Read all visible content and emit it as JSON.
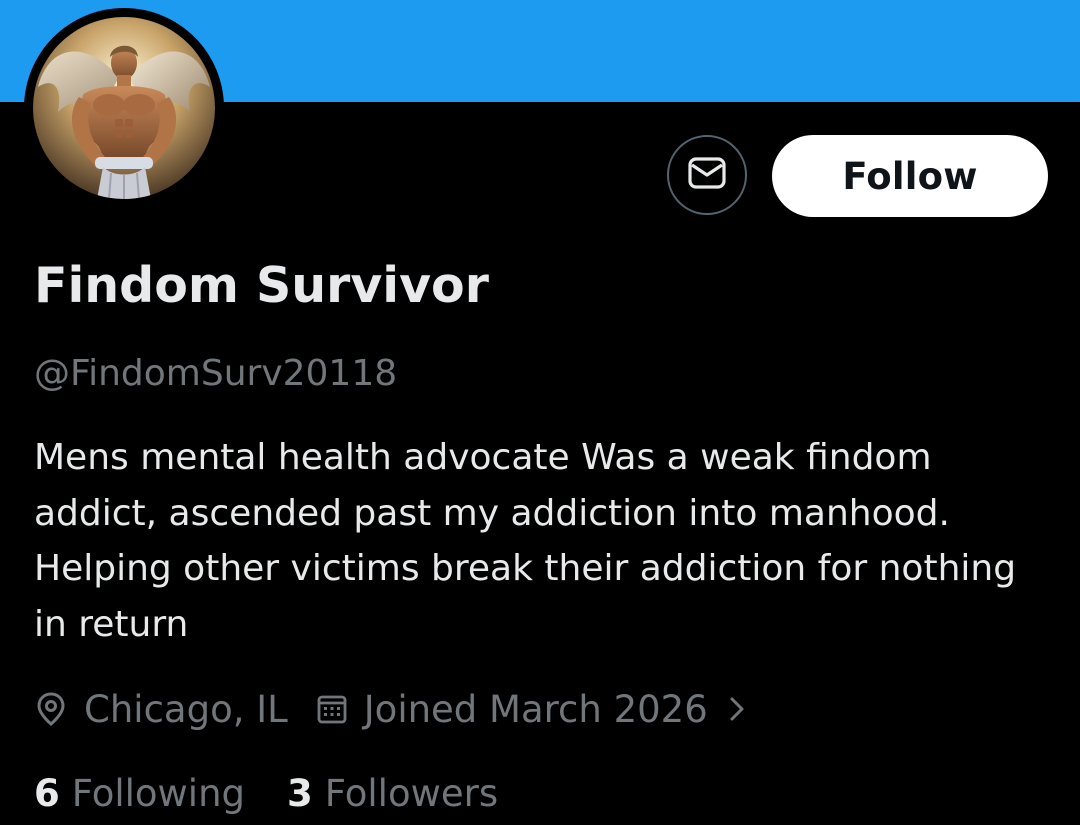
{
  "profile": {
    "display_name": "Findom Survivor",
    "handle": "@FindomSurv20118",
    "bio": "Mens mental health advocate Was a weak findom addict, ascended past my addiction into manhood. Helping other victims break their addiction for nothing in return",
    "location": "Chicago, IL",
    "joined": "Joined March 2026",
    "following_count": "6",
    "following_label": "Following",
    "followers_count": "3",
    "followers_label": "Followers"
  },
  "actions": {
    "follow_label": "Follow",
    "message_icon": "envelope-icon"
  },
  "icons": {
    "location": "map-pin-icon",
    "joined": "calendar-icon",
    "more": "chevron-right-icon"
  },
  "colors": {
    "banner": "#1d9bf0",
    "background": "#000000",
    "text_primary": "#e7e9ea",
    "text_secondary": "#71767b",
    "button_bg": "#ffffff",
    "button_text": "#0f1419",
    "border": "#536471"
  }
}
